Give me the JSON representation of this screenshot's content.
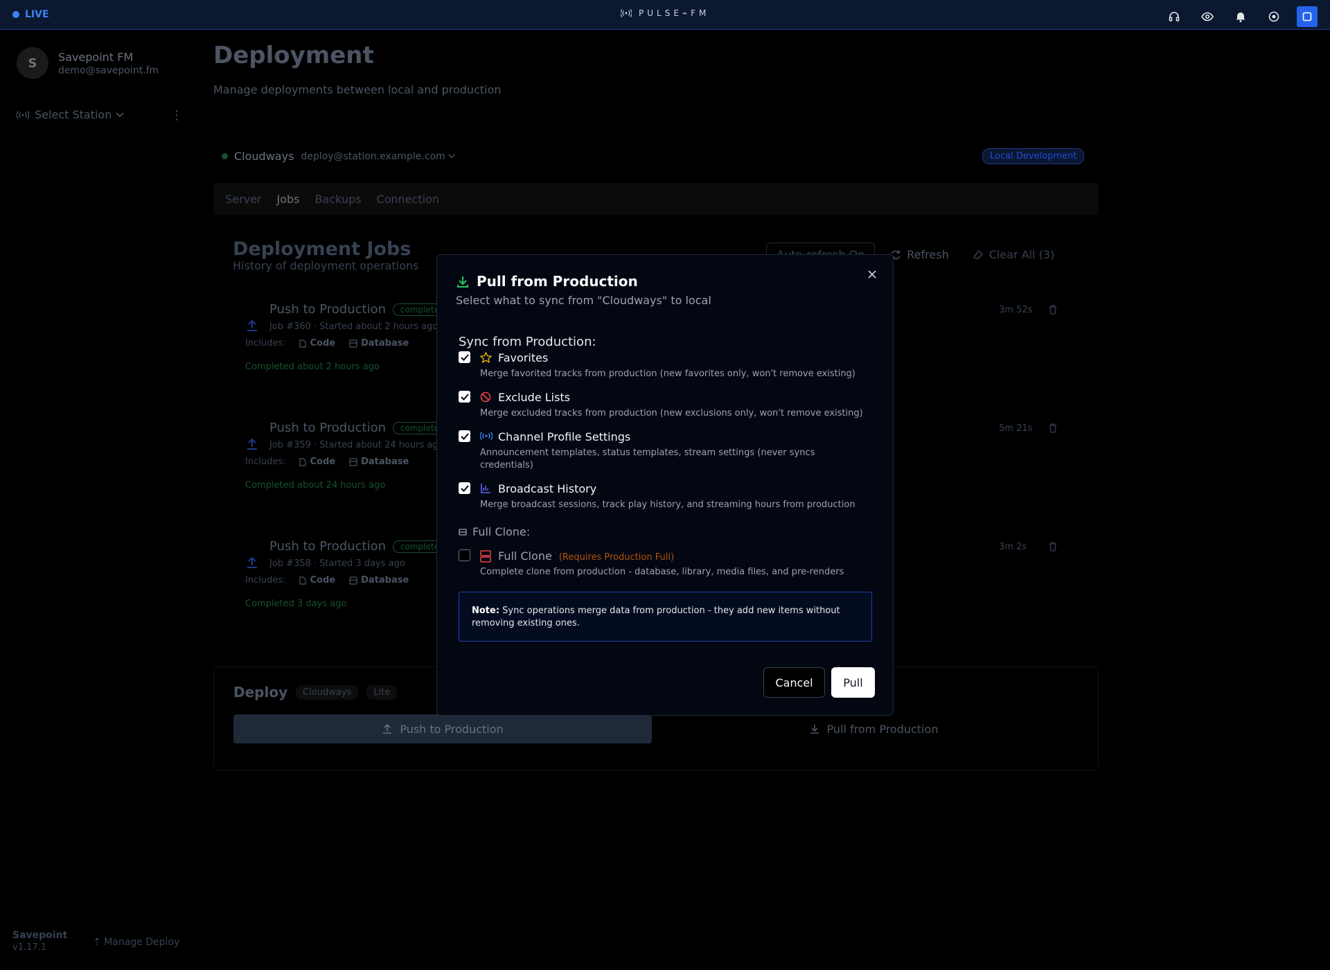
{
  "topbar": {
    "live_label": "LIVE",
    "brand": "PULSE⌁FM",
    "icons": [
      "headphones-icon",
      "eye-icon",
      "bell-icon",
      "record-icon",
      "square-icon"
    ]
  },
  "sidebar": {
    "avatar_initial": "S",
    "profile_name": "Savepoint FM",
    "profile_email": "demo@savepoint.fm",
    "station_select": "Select Station",
    "footer_name": "Savepoint",
    "footer_version": "v1.17.1",
    "manage_deploy": "Manage Deploy"
  },
  "page": {
    "title": "Deployment",
    "subtitle": "Manage deployments between local and production",
    "connection_name": "Cloudways",
    "connection_email": "deploy@station.example.com",
    "env_badge": "Local Development",
    "tabs": [
      "Server",
      "Jobs",
      "Backups",
      "Connection"
    ],
    "active_tab": "Jobs"
  },
  "jobs": {
    "title": "Deployment Jobs",
    "subtitle": "History of deployment operations",
    "auto_refresh": "Auto-refresh On",
    "refresh": "Refresh",
    "clear_all": "Clear All (3)",
    "includes_label": "Includes:",
    "items": [
      {
        "title": "Push to Production",
        "badge": "completed",
        "meta": "Job #360 · Started about 2 hours ago",
        "inc1": "Code",
        "inc2": "Database",
        "done": "Completed about 2 hours ago",
        "duration": "3m 52s"
      },
      {
        "title": "Push to Production",
        "badge": "completed",
        "meta": "Job #359 · Started about 24 hours ago",
        "inc1": "Code",
        "inc2": "Database",
        "done": "Completed about 24 hours ago",
        "duration": "5m 21s"
      },
      {
        "title": "Push to Production",
        "badge": "completed",
        "meta": "Job #358 · Started 3 days ago",
        "inc1": "Code",
        "inc2": "Database",
        "done": "Completed 3 days ago",
        "duration": "3m 2s"
      }
    ]
  },
  "deploy": {
    "title": "Deploy",
    "chip1": "Cloudways",
    "chip2": "Lite",
    "push": "Push to Production",
    "pull": "Pull from Production"
  },
  "modal": {
    "title": "Pull from Production",
    "subtitle": "Select what to sync from \"Cloudways\" to local",
    "section_label": "Sync from Production:",
    "options": [
      {
        "label": "Favorites",
        "desc": "Merge favorited tracks from production (new favorites only, won't remove existing)",
        "checked": true
      },
      {
        "label": "Exclude Lists",
        "desc": "Merge excluded tracks from production (new exclusions only, won't remove existing)",
        "checked": true
      },
      {
        "label": "Channel Profile Settings",
        "desc": "Announcement templates, status templates, stream settings (never syncs credentials)",
        "checked": true
      },
      {
        "label": "Broadcast History",
        "desc": "Merge broadcast sessions, track play history, and streaming hours from production",
        "checked": true
      }
    ],
    "full_clone_section": "Full Clone:",
    "full_clone": {
      "label": "Full Clone",
      "requirement": "(Requires Production Full)",
      "desc": "Complete clone from production - database, library, media files, and pre-renders",
      "checked": false
    },
    "note_bold": "Note:",
    "note_text": " Sync operations merge data from production - they add new items without removing existing ones.",
    "cancel": "Cancel",
    "pull": "Pull"
  },
  "colors": {
    "accent": "#2563eb",
    "success": "#22c55e",
    "danger": "#ef4444",
    "warning": "#eab308",
    "info": "#3b82f6"
  }
}
